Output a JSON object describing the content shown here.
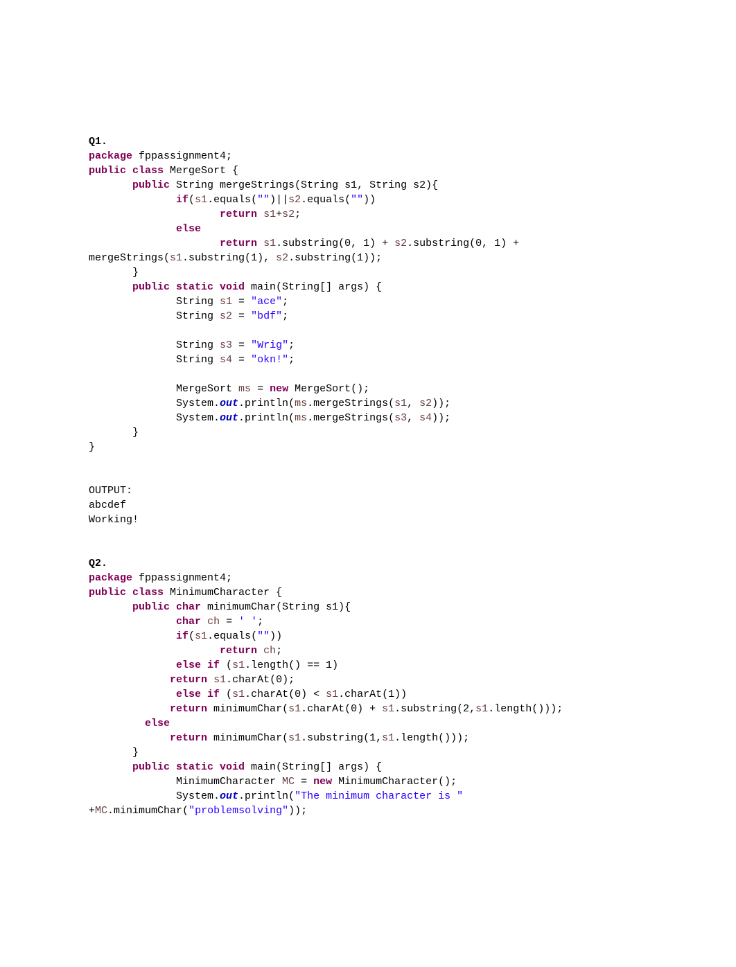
{
  "q1": {
    "heading": "Q1.",
    "lines": [
      [
        [
          "keyword",
          "package"
        ],
        [
          "plain",
          " fppassignment4;"
        ]
      ],
      [
        [
          "keyword",
          "public class"
        ],
        [
          "plain",
          " MergeSort {"
        ]
      ],
      [
        [
          "plain",
          "       "
        ],
        [
          "keyword",
          "public"
        ],
        [
          "plain",
          " String mergeStrings(String s1, String s2){"
        ]
      ],
      [
        [
          "plain",
          "              "
        ],
        [
          "keyword",
          "if"
        ],
        [
          "plain",
          "("
        ],
        [
          "var",
          "s1"
        ],
        [
          "plain",
          ".equals("
        ],
        [
          "string",
          "\"\""
        ],
        [
          "plain",
          ")||"
        ],
        [
          "var",
          "s2"
        ],
        [
          "plain",
          ".equals("
        ],
        [
          "string",
          "\"\""
        ],
        [
          "plain",
          "))"
        ]
      ],
      [
        [
          "plain",
          "                     "
        ],
        [
          "keyword",
          "return"
        ],
        [
          "plain",
          " "
        ],
        [
          "var",
          "s1"
        ],
        [
          "plain",
          "+"
        ],
        [
          "var",
          "s2"
        ],
        [
          "plain",
          ";"
        ]
      ],
      [
        [
          "plain",
          "              "
        ],
        [
          "keyword",
          "else"
        ]
      ],
      [
        [
          "plain",
          "                     "
        ],
        [
          "keyword",
          "return"
        ],
        [
          "plain",
          " "
        ],
        [
          "var",
          "s1"
        ],
        [
          "plain",
          ".substring(0, 1) + "
        ],
        [
          "var",
          "s2"
        ],
        [
          "plain",
          ".substring(0, 1) +"
        ]
      ],
      [
        [
          "plain",
          "mergeStrings("
        ],
        [
          "var",
          "s1"
        ],
        [
          "plain",
          ".substring(1), "
        ],
        [
          "var",
          "s2"
        ],
        [
          "plain",
          ".substring(1));"
        ]
      ],
      [
        [
          "plain",
          "       }"
        ]
      ],
      [
        [
          "plain",
          "       "
        ],
        [
          "keyword",
          "public static void"
        ],
        [
          "plain",
          " main(String[] args) {"
        ]
      ],
      [
        [
          "plain",
          "              String "
        ],
        [
          "var",
          "s1"
        ],
        [
          "plain",
          " = "
        ],
        [
          "string",
          "\"ace\""
        ],
        [
          "plain",
          ";"
        ]
      ],
      [
        [
          "plain",
          "              String "
        ],
        [
          "var",
          "s2"
        ],
        [
          "plain",
          " = "
        ],
        [
          "string",
          "\"bdf\""
        ],
        [
          "plain",
          ";"
        ]
      ],
      [
        [
          "plain",
          ""
        ]
      ],
      [
        [
          "plain",
          "              String "
        ],
        [
          "var",
          "s3"
        ],
        [
          "plain",
          " = "
        ],
        [
          "string",
          "\"Wrig\""
        ],
        [
          "plain",
          ";"
        ]
      ],
      [
        [
          "plain",
          "              String "
        ],
        [
          "var",
          "s4"
        ],
        [
          "plain",
          " = "
        ],
        [
          "string",
          "\"okn!\""
        ],
        [
          "plain",
          ";"
        ]
      ],
      [
        [
          "plain",
          ""
        ]
      ],
      [
        [
          "plain",
          "              MergeSort "
        ],
        [
          "var",
          "ms"
        ],
        [
          "plain",
          " = "
        ],
        [
          "keyword",
          "new"
        ],
        [
          "plain",
          " MergeSort();"
        ]
      ],
      [
        [
          "plain",
          "              System."
        ],
        [
          "static-italic",
          "out"
        ],
        [
          "plain",
          ".println("
        ],
        [
          "var",
          "ms"
        ],
        [
          "plain",
          ".mergeStrings("
        ],
        [
          "var",
          "s1"
        ],
        [
          "plain",
          ", "
        ],
        [
          "var",
          "s2"
        ],
        [
          "plain",
          "));"
        ]
      ],
      [
        [
          "plain",
          "              System."
        ],
        [
          "static-italic",
          "out"
        ],
        [
          "plain",
          ".println("
        ],
        [
          "var",
          "ms"
        ],
        [
          "plain",
          ".mergeStrings("
        ],
        [
          "var",
          "s3"
        ],
        [
          "plain",
          ", "
        ],
        [
          "var",
          "s4"
        ],
        [
          "plain",
          "));"
        ]
      ],
      [
        [
          "plain",
          "       }"
        ]
      ],
      [
        [
          "plain",
          "}"
        ]
      ]
    ],
    "output_label": "OUTPUT:",
    "output_lines": [
      "abcdef",
      "Working!"
    ]
  },
  "q2": {
    "heading": "Q2.",
    "lines": [
      [
        [
          "keyword",
          "package"
        ],
        [
          "plain",
          " fppassignment4;"
        ]
      ],
      [
        [
          "keyword",
          "public class"
        ],
        [
          "plain",
          " MinimumCharacter {"
        ]
      ],
      [
        [
          "plain",
          "       "
        ],
        [
          "keyword",
          "public char"
        ],
        [
          "plain",
          " minimumChar(String s1){"
        ]
      ],
      [
        [
          "plain",
          "              "
        ],
        [
          "keyword",
          "char"
        ],
        [
          "plain",
          " "
        ],
        [
          "var",
          "ch"
        ],
        [
          "plain",
          " = "
        ],
        [
          "string",
          "' '"
        ],
        [
          "plain",
          ";"
        ]
      ],
      [
        [
          "plain",
          "              "
        ],
        [
          "keyword",
          "if"
        ],
        [
          "plain",
          "("
        ],
        [
          "var",
          "s1"
        ],
        [
          "plain",
          ".equals("
        ],
        [
          "string",
          "\"\""
        ],
        [
          "plain",
          "))"
        ]
      ],
      [
        [
          "plain",
          "                     "
        ],
        [
          "keyword",
          "return"
        ],
        [
          "plain",
          " "
        ],
        [
          "var",
          "ch"
        ],
        [
          "plain",
          ";"
        ]
      ],
      [
        [
          "plain",
          "              "
        ],
        [
          "keyword",
          "else if"
        ],
        [
          "plain",
          " ("
        ],
        [
          "var",
          "s1"
        ],
        [
          "plain",
          ".length() == 1)"
        ]
      ],
      [
        [
          "plain",
          "             "
        ],
        [
          "keyword",
          "return"
        ],
        [
          "plain",
          " "
        ],
        [
          "var",
          "s1"
        ],
        [
          "plain",
          ".charAt(0);"
        ]
      ],
      [
        [
          "plain",
          "              "
        ],
        [
          "keyword",
          "else if"
        ],
        [
          "plain",
          " ("
        ],
        [
          "var",
          "s1"
        ],
        [
          "plain",
          ".charAt(0) < "
        ],
        [
          "var",
          "s1"
        ],
        [
          "plain",
          ".charAt(1))"
        ]
      ],
      [
        [
          "plain",
          "             "
        ],
        [
          "keyword",
          "return"
        ],
        [
          "plain",
          " minimumChar("
        ],
        [
          "var",
          "s1"
        ],
        [
          "plain",
          ".charAt(0) + "
        ],
        [
          "var",
          "s1"
        ],
        [
          "plain",
          ".substring(2,"
        ],
        [
          "var",
          "s1"
        ],
        [
          "plain",
          ".length()));"
        ]
      ],
      [
        [
          "plain",
          "         "
        ],
        [
          "keyword",
          "else"
        ]
      ],
      [
        [
          "plain",
          "             "
        ],
        [
          "keyword",
          "return"
        ],
        [
          "plain",
          " minimumChar("
        ],
        [
          "var",
          "s1"
        ],
        [
          "plain",
          ".substring(1,"
        ],
        [
          "var",
          "s1"
        ],
        [
          "plain",
          ".length()));"
        ]
      ],
      [
        [
          "plain",
          "       }"
        ]
      ],
      [
        [
          "plain",
          "       "
        ],
        [
          "keyword",
          "public static void"
        ],
        [
          "plain",
          " main(String[] args) {"
        ]
      ],
      [
        [
          "plain",
          "              MinimumCharacter "
        ],
        [
          "var",
          "MC"
        ],
        [
          "plain",
          " = "
        ],
        [
          "keyword",
          "new"
        ],
        [
          "plain",
          " MinimumCharacter();"
        ]
      ],
      [
        [
          "plain",
          "              System."
        ],
        [
          "static-italic",
          "out"
        ],
        [
          "plain",
          ".println("
        ],
        [
          "string",
          "\"The minimum character is \""
        ]
      ],
      [
        [
          "plain",
          "+"
        ],
        [
          "var",
          "MC"
        ],
        [
          "plain",
          ".minimumChar("
        ],
        [
          "string",
          "\"problemsolving\""
        ],
        [
          "plain",
          "));"
        ]
      ]
    ]
  }
}
